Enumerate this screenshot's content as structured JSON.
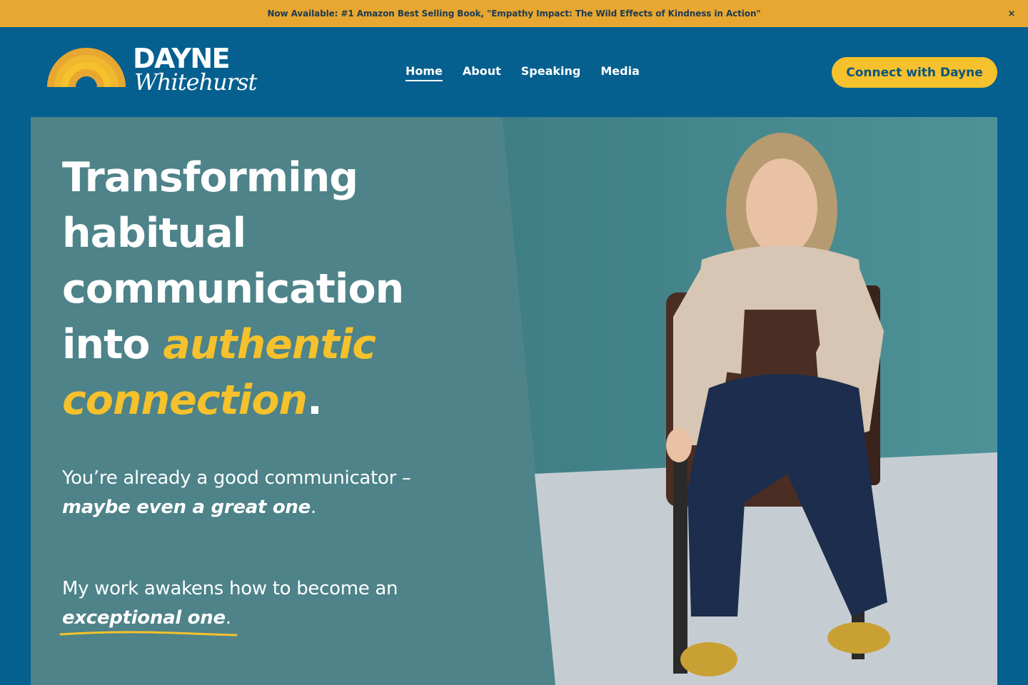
{
  "announcement": {
    "text": "Now Available: #1 Amazon Best Selling Book, \"Empathy Impact: The Wild Effects of Kindness in Action\"",
    "close_label": "×"
  },
  "logo": {
    "name": "DAYNE",
    "script": "Whitehurst"
  },
  "nav": {
    "items": [
      {
        "label": "Home",
        "active": true
      },
      {
        "label": "About"
      },
      {
        "label": "Speaking"
      },
      {
        "label": "Media"
      }
    ]
  },
  "cta": {
    "label": "Connect with Dayne"
  },
  "hero": {
    "headline": {
      "line1": "Transforming",
      "line2": "habitual",
      "line3": "communication",
      "line4_plain": "into ",
      "line4_accent": "authentic",
      "line5_accent": "connection",
      "line5_end": "."
    },
    "sub1": {
      "plain1": "You’re already a good communicator – ",
      "em": "maybe even a great one",
      "end": "."
    },
    "sub2": {
      "plain1": "My work awakens how to become an ",
      "em": "exceptional one",
      "end": "."
    }
  },
  "colors": {
    "announcement_bg": "#e8a730",
    "header_bg": "#05608f",
    "accent_yellow": "#f5c12c",
    "hero_bg": "#4d8389"
  }
}
